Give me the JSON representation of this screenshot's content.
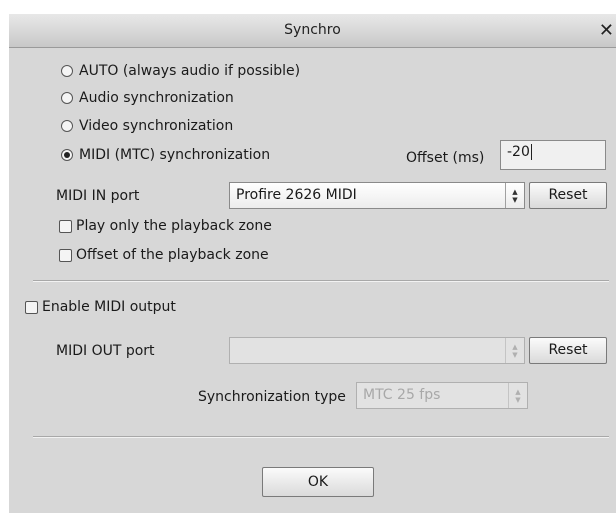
{
  "window": {
    "title": "Synchro",
    "close_glyph": "✕"
  },
  "sync_options": [
    {
      "label": "AUTO (always audio if possible)",
      "selected": false
    },
    {
      "label": "Audio synchronization",
      "selected": false
    },
    {
      "label": "Video synchronization",
      "selected": false
    },
    {
      "label": "MIDI (MTC) synchronization",
      "selected": true
    }
  ],
  "offset": {
    "label": "Offset (ms)",
    "value": "-20"
  },
  "midi_in": {
    "label": "MIDI IN port",
    "value": "Profire 2626 MIDI",
    "reset_label": "Reset"
  },
  "checks": [
    {
      "label": "Play only the playback zone",
      "checked": false
    },
    {
      "label": "Offset of the playback zone",
      "checked": false
    }
  ],
  "midi_output": {
    "label": "Enable MIDI output",
    "checked": false
  },
  "midi_out": {
    "label": "MIDI OUT port",
    "value": "",
    "reset_label": "Reset"
  },
  "sync_type": {
    "label": "Synchronization type",
    "value": "MTC 25 fps"
  },
  "ok_label": "OK",
  "icons": {
    "spinner": "up-down-arrows-icon"
  }
}
